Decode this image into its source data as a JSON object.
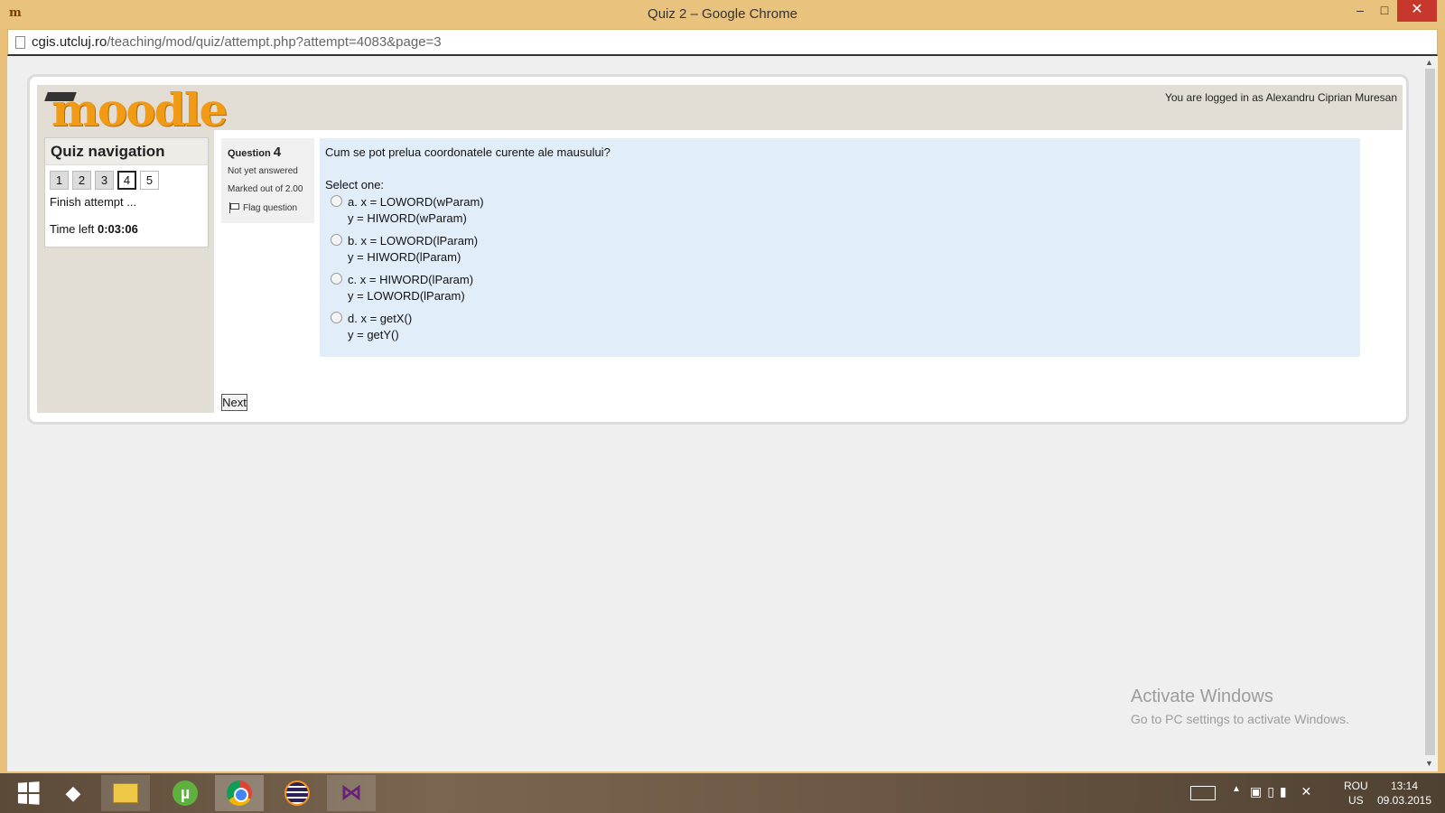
{
  "window": {
    "app_icon": "m",
    "title": "Quiz 2 – Google Chrome",
    "minimize": "–",
    "maximize": "□",
    "close": "✕"
  },
  "address": {
    "url_host": "cgis.utcluj.ro",
    "url_path": "/teaching/mod/quiz/attempt.php?attempt=4083&page=3"
  },
  "header": {
    "logo_text": "moodle",
    "logged_in": "You are logged in as Alexandru Ciprian Muresan"
  },
  "quiz_nav": {
    "title": "Quiz navigation",
    "buttons": [
      {
        "label": "1",
        "state": "answered"
      },
      {
        "label": "2",
        "state": "answered"
      },
      {
        "label": "3",
        "state": "answered"
      },
      {
        "label": "4",
        "state": "current"
      },
      {
        "label": "5",
        "state": "notyet"
      }
    ],
    "finish": "Finish attempt ...",
    "time_label": "Time left",
    "time_value": "0:03:06"
  },
  "question_info": {
    "label": "Question",
    "number": "4",
    "state": "Not yet answered",
    "grade": "Marked out of 2.00",
    "flag": "Flag question"
  },
  "question": {
    "text": "Cum se pot prelua coordonatele curente ale mausului?",
    "prompt": "Select one:",
    "answers": [
      {
        "letter": "a.",
        "line1": "x = LOWORD(wParam)",
        "line2": "y = HIWORD(wParam)"
      },
      {
        "letter": "b.",
        "line1": "x = LOWORD(lParam)",
        "line2": "y = HIWORD(lParam)"
      },
      {
        "letter": "c.",
        "line1": "x = HIWORD(lParam)",
        "line2": "y = LOWORD(lParam)"
      },
      {
        "letter": "d.",
        "line1": "x = getX()",
        "line2": "y = getY()"
      }
    ]
  },
  "next_label": "Next",
  "watermark": {
    "title": "Activate Windows",
    "subtitle": "Go to PC settings to activate Windows."
  },
  "taskbar": {
    "apps": [
      "start-icon",
      "ghost-icon",
      "file-explorer-icon",
      "utorrent-icon",
      "chrome-icon",
      "eclipse-icon",
      "visual-studio-icon"
    ],
    "lang1": "ROU",
    "lang2": "US",
    "time": "13:14",
    "date": "09.03.2015"
  }
}
